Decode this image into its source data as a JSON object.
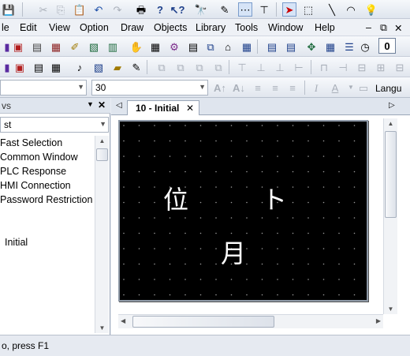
{
  "menu": {
    "items": [
      {
        "label": "le"
      },
      {
        "label": "Edit"
      },
      {
        "label": "View"
      },
      {
        "label": "Option"
      },
      {
        "label": "Draw"
      },
      {
        "label": "Objects"
      },
      {
        "label": "Library"
      },
      {
        "label": "Tools"
      },
      {
        "label": "Window"
      },
      {
        "label": "Help"
      }
    ],
    "window_controls": [
      "–",
      "⧉",
      "✕"
    ],
    "zoom_value": "0"
  },
  "format_bar": {
    "font_size": "30",
    "language_label": "Langu"
  },
  "left_pane": {
    "title": "vs",
    "close_label": "✕",
    "pin_label": "▼",
    "combo_value": "st",
    "items": [
      "Fast Selection",
      "Common Window",
      "PLC Response",
      "HMI Connection",
      "Password Restriction"
    ],
    "extra_item": "Initial"
  },
  "doc": {
    "tab_label": "10 - Initial",
    "tab_close": "✕",
    "chars": [
      "位",
      "ト",
      "月"
    ]
  },
  "statusbar": {
    "text": "o, press F1"
  },
  "colors": {
    "screen_bg": "#000000",
    "screen_text": "#ffffff",
    "toolbar_bg": "#e1e6ee"
  }
}
